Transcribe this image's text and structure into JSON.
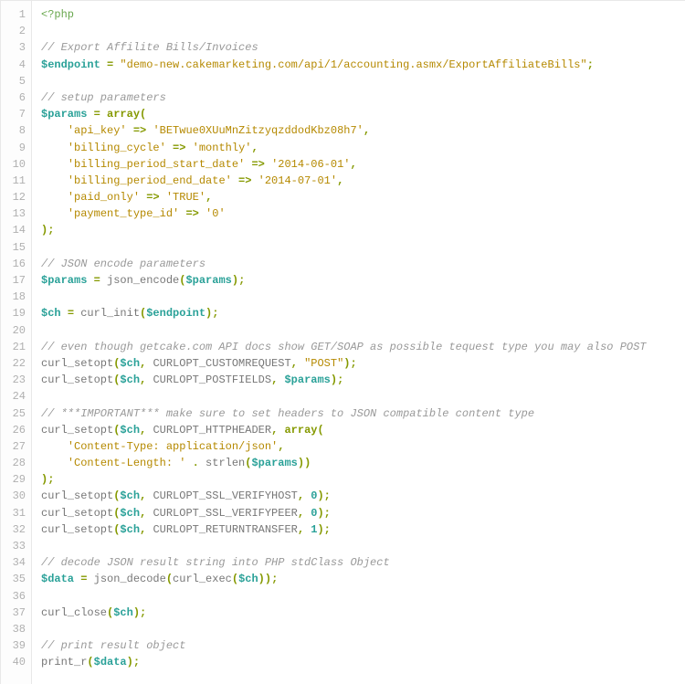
{
  "line_count": 40,
  "code_lines": [
    [
      [
        "t-tag",
        "<?php"
      ]
    ],
    [],
    [
      [
        "t-com",
        "// Export Affilite Bills/Invoices"
      ]
    ],
    [
      [
        "t-var",
        "$endpoint"
      ],
      [
        "t-punct",
        " "
      ],
      [
        "t-op",
        "="
      ],
      [
        "t-punct",
        " "
      ],
      [
        "t-str",
        "\"demo-new.cakemarketing.com/api/1/accounting.asmx/ExportAffiliateBills\""
      ],
      [
        "t-op",
        ";"
      ]
    ],
    [],
    [
      [
        "t-com",
        "// setup parameters"
      ]
    ],
    [
      [
        "t-var",
        "$params"
      ],
      [
        "t-punct",
        " "
      ],
      [
        "t-op",
        "="
      ],
      [
        "t-punct",
        " "
      ],
      [
        "t-kw",
        "array"
      ],
      [
        "t-op",
        "("
      ]
    ],
    [
      [
        "t-punct",
        "    "
      ],
      [
        "t-str",
        "'api_key'"
      ],
      [
        "t-punct",
        " "
      ],
      [
        "t-op",
        "=>"
      ],
      [
        "t-punct",
        " "
      ],
      [
        "t-str",
        "'BETwue0XUuMnZitzyqzddodKbz08h7'"
      ],
      [
        "t-op",
        ","
      ]
    ],
    [
      [
        "t-punct",
        "    "
      ],
      [
        "t-str",
        "'billing_cycle'"
      ],
      [
        "t-punct",
        " "
      ],
      [
        "t-op",
        "=>"
      ],
      [
        "t-punct",
        " "
      ],
      [
        "t-str",
        "'monthly'"
      ],
      [
        "t-op",
        ","
      ]
    ],
    [
      [
        "t-punct",
        "    "
      ],
      [
        "t-str",
        "'billing_period_start_date'"
      ],
      [
        "t-punct",
        " "
      ],
      [
        "t-op",
        "=>"
      ],
      [
        "t-punct",
        " "
      ],
      [
        "t-str",
        "'2014-06-01'"
      ],
      [
        "t-op",
        ","
      ]
    ],
    [
      [
        "t-punct",
        "    "
      ],
      [
        "t-str",
        "'billing_period_end_date'"
      ],
      [
        "t-punct",
        " "
      ],
      [
        "t-op",
        "=>"
      ],
      [
        "t-punct",
        " "
      ],
      [
        "t-str",
        "'2014-07-01'"
      ],
      [
        "t-op",
        ","
      ]
    ],
    [
      [
        "t-punct",
        "    "
      ],
      [
        "t-str",
        "'paid_only'"
      ],
      [
        "t-punct",
        " "
      ],
      [
        "t-op",
        "=>"
      ],
      [
        "t-punct",
        " "
      ],
      [
        "t-str",
        "'TRUE'"
      ],
      [
        "t-op",
        ","
      ]
    ],
    [
      [
        "t-punct",
        "    "
      ],
      [
        "t-str",
        "'payment_type_id'"
      ],
      [
        "t-punct",
        " "
      ],
      [
        "t-op",
        "=>"
      ],
      [
        "t-punct",
        " "
      ],
      [
        "t-str",
        "'0'"
      ]
    ],
    [
      [
        "t-op",
        ");"
      ]
    ],
    [],
    [
      [
        "t-com",
        "// JSON encode parameters"
      ]
    ],
    [
      [
        "t-var",
        "$params"
      ],
      [
        "t-punct",
        " "
      ],
      [
        "t-op",
        "="
      ],
      [
        "t-punct",
        " "
      ],
      [
        "t-func",
        "json_encode"
      ],
      [
        "t-op",
        "("
      ],
      [
        "t-var",
        "$params"
      ],
      [
        "t-op",
        ");"
      ]
    ],
    [],
    [
      [
        "t-var",
        "$ch"
      ],
      [
        "t-punct",
        " "
      ],
      [
        "t-op",
        "="
      ],
      [
        "t-punct",
        " "
      ],
      [
        "t-func",
        "curl_init"
      ],
      [
        "t-op",
        "("
      ],
      [
        "t-var",
        "$endpoint"
      ],
      [
        "t-op",
        ");"
      ]
    ],
    [],
    [
      [
        "t-com",
        "// even though getcake.com API docs show GET/SOAP as possible tequest type you may also POST"
      ]
    ],
    [
      [
        "t-func",
        "curl_setopt"
      ],
      [
        "t-op",
        "("
      ],
      [
        "t-var",
        "$ch"
      ],
      [
        "t-op",
        ","
      ],
      [
        "t-punct",
        " "
      ],
      [
        "t-const",
        "CURLOPT_CUSTOMREQUEST"
      ],
      [
        "t-op",
        ","
      ],
      [
        "t-punct",
        " "
      ],
      [
        "t-str",
        "\"POST\""
      ],
      [
        "t-op",
        ");"
      ]
    ],
    [
      [
        "t-func",
        "curl_setopt"
      ],
      [
        "t-op",
        "("
      ],
      [
        "t-var",
        "$ch"
      ],
      [
        "t-op",
        ","
      ],
      [
        "t-punct",
        " "
      ],
      [
        "t-const",
        "CURLOPT_POSTFIELDS"
      ],
      [
        "t-op",
        ","
      ],
      [
        "t-punct",
        " "
      ],
      [
        "t-var",
        "$params"
      ],
      [
        "t-op",
        ");"
      ]
    ],
    [],
    [
      [
        "t-com",
        "// ***IMPORTANT*** make sure to set headers to JSON compatible content type"
      ]
    ],
    [
      [
        "t-func",
        "curl_setopt"
      ],
      [
        "t-op",
        "("
      ],
      [
        "t-var",
        "$ch"
      ],
      [
        "t-op",
        ","
      ],
      [
        "t-punct",
        " "
      ],
      [
        "t-const",
        "CURLOPT_HTTPHEADER"
      ],
      [
        "t-op",
        ","
      ],
      [
        "t-punct",
        " "
      ],
      [
        "t-kw",
        "array"
      ],
      [
        "t-op",
        "("
      ]
    ],
    [
      [
        "t-punct",
        "    "
      ],
      [
        "t-str",
        "'Content-Type: application/json'"
      ],
      [
        "t-op",
        ","
      ]
    ],
    [
      [
        "t-punct",
        "    "
      ],
      [
        "t-str",
        "'Content-Length: '"
      ],
      [
        "t-punct",
        " "
      ],
      [
        "t-op",
        "."
      ],
      [
        "t-punct",
        " "
      ],
      [
        "t-func",
        "strlen"
      ],
      [
        "t-op",
        "("
      ],
      [
        "t-var",
        "$params"
      ],
      [
        "t-op",
        "))"
      ]
    ],
    [
      [
        "t-op",
        ");"
      ]
    ],
    [
      [
        "t-func",
        "curl_setopt"
      ],
      [
        "t-op",
        "("
      ],
      [
        "t-var",
        "$ch"
      ],
      [
        "t-op",
        ","
      ],
      [
        "t-punct",
        " "
      ],
      [
        "t-const",
        "CURLOPT_SSL_VERIFYHOST"
      ],
      [
        "t-op",
        ","
      ],
      [
        "t-punct",
        " "
      ],
      [
        "t-num",
        "0"
      ],
      [
        "t-op",
        ");"
      ]
    ],
    [
      [
        "t-func",
        "curl_setopt"
      ],
      [
        "t-op",
        "("
      ],
      [
        "t-var",
        "$ch"
      ],
      [
        "t-op",
        ","
      ],
      [
        "t-punct",
        " "
      ],
      [
        "t-const",
        "CURLOPT_SSL_VERIFYPEER"
      ],
      [
        "t-op",
        ","
      ],
      [
        "t-punct",
        " "
      ],
      [
        "t-num",
        "0"
      ],
      [
        "t-op",
        ");"
      ]
    ],
    [
      [
        "t-func",
        "curl_setopt"
      ],
      [
        "t-op",
        "("
      ],
      [
        "t-var",
        "$ch"
      ],
      [
        "t-op",
        ","
      ],
      [
        "t-punct",
        " "
      ],
      [
        "t-const",
        "CURLOPT_RETURNTRANSFER"
      ],
      [
        "t-op",
        ","
      ],
      [
        "t-punct",
        " "
      ],
      [
        "t-num",
        "1"
      ],
      [
        "t-op",
        ");"
      ]
    ],
    [],
    [
      [
        "t-com",
        "// decode JSON result string into PHP stdClass Object"
      ]
    ],
    [
      [
        "t-var",
        "$data"
      ],
      [
        "t-punct",
        " "
      ],
      [
        "t-op",
        "="
      ],
      [
        "t-punct",
        " "
      ],
      [
        "t-func",
        "json_decode"
      ],
      [
        "t-op",
        "("
      ],
      [
        "t-func",
        "curl_exec"
      ],
      [
        "t-op",
        "("
      ],
      [
        "t-var",
        "$ch"
      ],
      [
        "t-op",
        "));"
      ]
    ],
    [],
    [
      [
        "t-func",
        "curl_close"
      ],
      [
        "t-op",
        "("
      ],
      [
        "t-var",
        "$ch"
      ],
      [
        "t-op",
        ");"
      ]
    ],
    [],
    [
      [
        "t-com",
        "// print result object"
      ]
    ],
    [
      [
        "t-func",
        "print_r"
      ],
      [
        "t-op",
        "("
      ],
      [
        "t-var",
        "$data"
      ],
      [
        "t-op",
        ");"
      ]
    ]
  ]
}
